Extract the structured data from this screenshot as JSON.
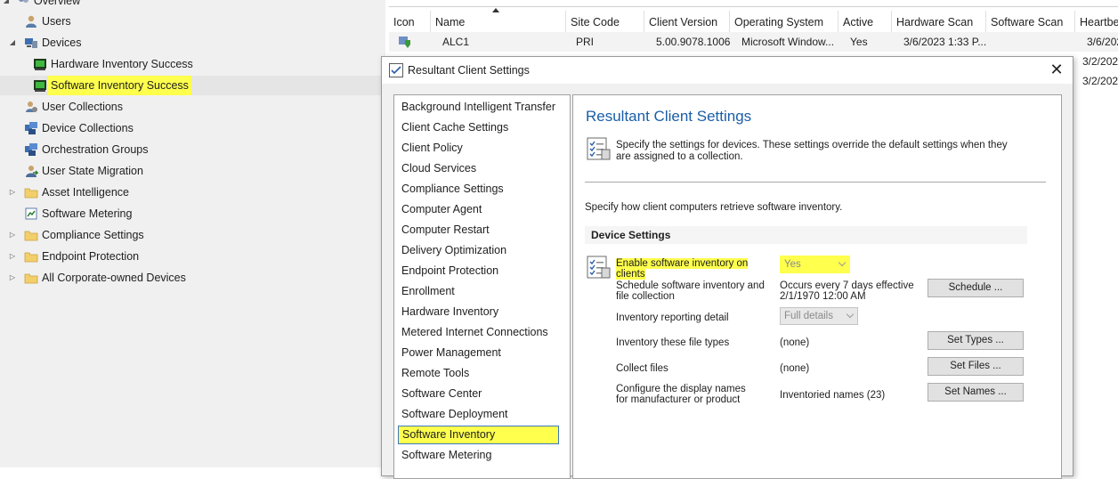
{
  "tree": {
    "overview_label": "Overview",
    "items": [
      {
        "label": "Users",
        "icon": "user-icon"
      },
      {
        "label": "Devices",
        "icon": "devices-icon"
      },
      {
        "label": "Hardware Inventory Success",
        "icon": "collection-icon"
      },
      {
        "label": "Software Inventory Success",
        "icon": "collection-icon"
      },
      {
        "label": "User Collections",
        "icon": "user-collection-icon"
      },
      {
        "label": "Device Collections",
        "icon": "device-collection-icon"
      },
      {
        "label": "Orchestration Groups",
        "icon": "orchestration-icon"
      },
      {
        "label": "User State Migration",
        "icon": "user-migration-icon"
      },
      {
        "label": "Asset Intelligence",
        "icon": "folder-icon"
      },
      {
        "label": "Software Metering",
        "icon": "metering-icon"
      },
      {
        "label": "Compliance Settings",
        "icon": "folder-icon"
      },
      {
        "label": "Endpoint Protection",
        "icon": "folder-icon"
      },
      {
        "label": "All Corporate-owned Devices",
        "icon": "folder-icon"
      }
    ]
  },
  "listview": {
    "columns": [
      "Icon",
      "Name",
      "Site Code",
      "Client Version",
      "Operating System",
      "Active",
      "Hardware Scan",
      "Software Scan",
      "Heartbe"
    ],
    "rows": [
      [
        "",
        "ALC1",
        "PRI",
        "5.00.9078.1006",
        "Microsoft Window...",
        "Yes",
        "3/6/2023 1:33 P...",
        "",
        "3/6/202"
      ]
    ],
    "heartbeat_extra": [
      "3/2/202",
      "3/2/202"
    ]
  },
  "dialog": {
    "title": "Resultant Client Settings",
    "close_glyph": "✕",
    "settings_list": [
      "Background Intelligent Transfer",
      "Client Cache Settings",
      "Client Policy",
      "Cloud Services",
      "Compliance Settings",
      "Computer Agent",
      "Computer Restart",
      "Delivery Optimization",
      "Endpoint Protection",
      "Enrollment",
      "Hardware Inventory",
      "Metered Internet Connections",
      "Power Management",
      "Remote Tools",
      "Software Center",
      "Software Deployment",
      "Software Inventory",
      "Software Metering"
    ],
    "selected_setting": "Software Inventory",
    "detail": {
      "title": "Resultant Client Settings",
      "intro": "Specify the settings for devices. These settings override the default settings when they are assigned to a collection.",
      "retrieve_text": "Specify how client computers retrieve software inventory.",
      "section_heading": "Device Settings",
      "settings": [
        {
          "label": "Enable software inventory on clients",
          "value": "Yes",
          "control": "dropdown"
        },
        {
          "label": "Schedule software inventory and file collection",
          "value": "Occurs every 7 days effective 2/1/1970 12:00 AM",
          "button": "Schedule ..."
        },
        {
          "label": "Inventory reporting detail",
          "value": "Full details",
          "control": "dropdown"
        },
        {
          "label": "Inventory these file types",
          "value": "(none)",
          "button": "Set Types ..."
        },
        {
          "label": "Collect files",
          "value": "(none)",
          "button": "Set Files ..."
        },
        {
          "label": "Configure the display names for manufacturer or product",
          "value": "Inventoried names (23)",
          "button": "Set Names ..."
        }
      ]
    }
  },
  "colors": {
    "highlight": "#ffff4d",
    "title_blue": "#1a5ea8",
    "selection_border": "#3c78c2"
  }
}
